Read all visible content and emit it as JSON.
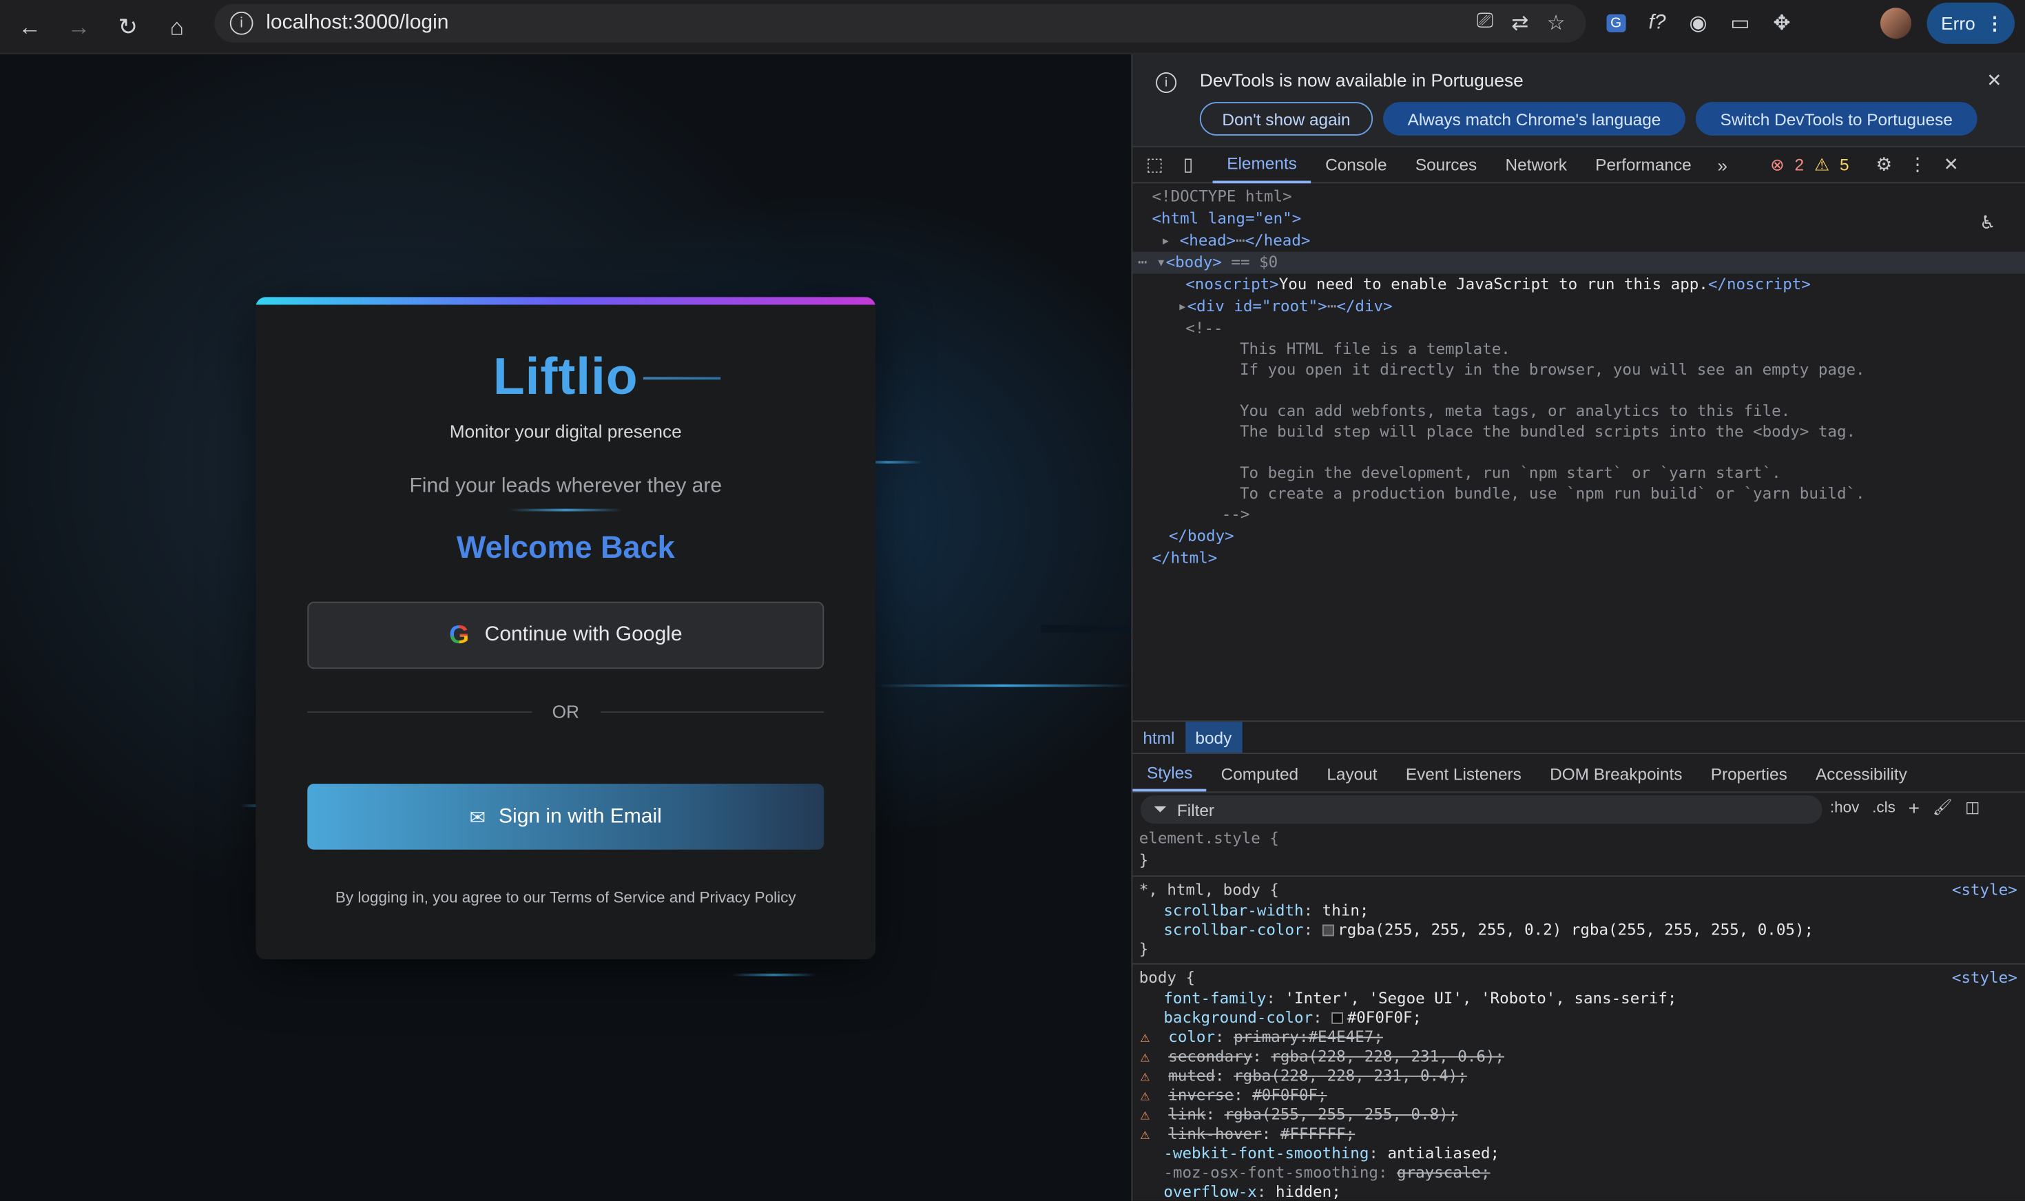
{
  "browser": {
    "url": "localhost:3000/login",
    "profile_label": "Erro"
  },
  "login": {
    "brand": "Liftlio",
    "tagline": "Monitor your digital presence",
    "subtitle": "Find your leads wherever they are",
    "heading": "Welcome Back",
    "google_button": "Continue with Google",
    "or_text": "OR",
    "email_button": "Sign in with Email",
    "legal": "By logging in, you agree to our Terms of Service and Privacy Policy"
  },
  "devtools": {
    "info_text": "DevTools is now available in Portuguese",
    "btn_dont_show": "Don't show again",
    "btn_match": "Always match Chrome's language",
    "btn_switch": "Switch DevTools to Portuguese",
    "tabs": [
      "Elements",
      "Console",
      "Sources",
      "Network",
      "Performance"
    ],
    "error_count": "2",
    "warn_count": "5",
    "breadcrumbs": [
      "html",
      "body"
    ],
    "style_tabs": [
      "Styles",
      "Computed",
      "Layout",
      "Event Listeners",
      "DOM Breakpoints",
      "Properties",
      "Accessibility"
    ],
    "filter_placeholder": "Filter",
    "hov": ":hov",
    "cls": ".cls"
  },
  "dom": {
    "doctype": "<!DOCTYPE html>",
    "html_open": "<html lang=\"en\">",
    "head": "<head>",
    "head_close": "</head>",
    "body": "<body>",
    "body_marker": "== $0",
    "noscript_open": "<noscript>",
    "noscript_text": "You need to enable JavaScript to run this app.",
    "noscript_close": "</noscript>",
    "root_div": "<div id=\"root\">",
    "root_div_close": "</div>",
    "comment_open": "<!--",
    "comment_lines": [
      "This HTML file is a template.",
      "If you open it directly in the browser, you will see an empty page.",
      "",
      "You can add webfonts, meta tags, or analytics to this file.",
      "The build step will place the bundled scripts into the <body> tag.",
      "",
      "To begin the development, run `npm start` or `yarn start`.",
      "To create a production bundle, use `npm run build` or `yarn build`."
    ],
    "comment_close": "-->",
    "body_close": "</body>",
    "html_close": "</html>"
  },
  "styles": {
    "element_style": "element.style {",
    "close_brace": "}",
    "rule1_selector": "*, html, body {",
    "rule1_src": "<style>",
    "rule1_props": [
      {
        "name": "scrollbar-width",
        "value": "thin;"
      },
      {
        "name": "scrollbar-color",
        "value": "rgba(255, 255, 255, 0.2) rgba(255, 255, 255, 0.05);"
      }
    ],
    "rule2_selector": "body {",
    "rule2_src": "<style>",
    "rule2_props": [
      {
        "name": "font-family",
        "value": "'Inter', 'Segoe UI', 'Roboto', sans-serif;"
      },
      {
        "name": "background-color",
        "value": "#0F0F0F;"
      },
      {
        "name": "color",
        "value": "primary:#E4E4E7;"
      },
      {
        "name": "secondary",
        "value": "rgba(228, 228, 231, 0.6);"
      },
      {
        "name": "muted",
        "value": "rgba(228, 228, 231, 0.4);"
      },
      {
        "name": "inverse",
        "value": "#0F0F0F;"
      },
      {
        "name": "link",
        "value": "rgba(255, 255, 255, 0.8);"
      },
      {
        "name": "link-hover",
        "value": "#FFFFFF;"
      },
      {
        "name": "-webkit-font-smoothing",
        "value": "antialiased;"
      },
      {
        "name": "-moz-osx-font-smoothing",
        "value": "grayscale;"
      },
      {
        "name": "overflow-x",
        "value": "hidden;"
      }
    ]
  }
}
